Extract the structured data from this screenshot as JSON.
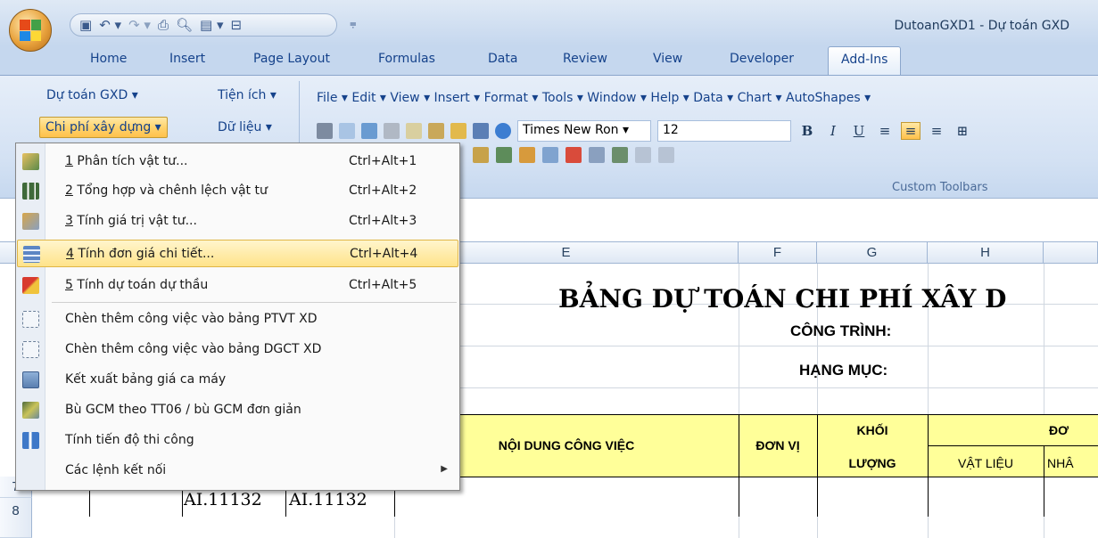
{
  "window": {
    "title": "DutoanGXD1 - Dự toán GXD",
    "qat_icons": [
      "save-icon",
      "undo-icon",
      "redo-icon",
      "print-preview-icon",
      "print-icon",
      "customize-icon"
    ]
  },
  "tabs": [
    "Home",
    "Insert",
    "Page Layout",
    "Formulas",
    "Data",
    "Review",
    "View",
    "Developer",
    "Add-Ins"
  ],
  "active_tab": "Add-Ins",
  "ribbon": {
    "left": {
      "du_toan": "Dự toán GXD ▾",
      "tien_ich": "Tiện ích ▾",
      "chi_phi": "Chi phí xây dựng ▾",
      "du_lieu": "Dữ liệu ▾"
    },
    "menu_bar": "File ▾  Edit ▾  View ▾  Insert ▾  Format ▾  Tools ▾  Window ▾  Help ▾  Data ▾  Chart ▾  AutoShapes ▾",
    "font_name": "Times New Ron ▾",
    "font_size": "12",
    "format_buttons": [
      "B",
      "I",
      "U"
    ],
    "group_label": "Custom Toolbars"
  },
  "dropdown": {
    "items": [
      {
        "num": "1",
        "label": " Phân tích vật tư...",
        "shortcut": "Ctrl+Alt+1",
        "icon": "material-analysis-icon"
      },
      {
        "num": "2",
        "label": " Tổng hợp và chênh lệch vật tư",
        "shortcut": "Ctrl+Alt+2",
        "icon": "summary-chart-icon"
      },
      {
        "num": "3",
        "label": " Tính giá trị vật tư...",
        "shortcut": "Ctrl+Alt+3",
        "icon": "calculate-value-icon"
      },
      {
        "num": "4",
        "label": " Tính đơn giá chi tiết...",
        "shortcut": "Ctrl+Alt+4",
        "icon": "unit-price-table-icon"
      },
      {
        "num": "5",
        "label": " Tính dự toán dự thầu",
        "shortcut": "Ctrl+Alt+5",
        "icon": "bid-estimate-icon"
      },
      {
        "num": "",
        "label": "Chèn thêm công việc vào bảng PTVT XD",
        "shortcut": "",
        "icon": "insert-ptvt-icon"
      },
      {
        "num": "",
        "label": "Chèn thêm công việc vào bảng DGCT XD",
        "shortcut": "",
        "icon": "insert-dgct-icon"
      },
      {
        "num": "",
        "label": "Kết xuất bảng giá ca máy",
        "shortcut": "",
        "icon": "calculator-icon"
      },
      {
        "num": "",
        "label": "Bù GCM theo TT06 / bù GCM đơn giản",
        "shortcut": "",
        "icon": "compensation-icon"
      },
      {
        "num": "",
        "label": "Tính tiến độ thi công",
        "shortcut": "",
        "icon": "schedule-icon"
      },
      {
        "num": "",
        "label": "Các lệnh kết nối",
        "shortcut": "",
        "icon": ""
      }
    ],
    "highlighted_index": 3
  },
  "sheet": {
    "columns": [
      "E",
      "F",
      "G",
      "H"
    ],
    "row_numbers": [
      "7",
      "8"
    ],
    "title": "BẢNG DỰ TOÁN CHI PHÍ XÂY D",
    "cong_trinh": "CÔNG TRÌNH:",
    "hang_muc": "HẠNG MỤC:",
    "header": {
      "noi_dung": "NỘI DUNG CÔNG VIỆC",
      "don_vi": "ĐƠN VỊ",
      "khoi": "KHỐI",
      "luong": "LƯỢNG",
      "don": "ĐƠ",
      "vat_lieu": "VẬT LIỆU",
      "nha": "NHÂ"
    },
    "cell_ai_1": "AI.11132",
    "cell_ai_2": "AI.11132"
  }
}
